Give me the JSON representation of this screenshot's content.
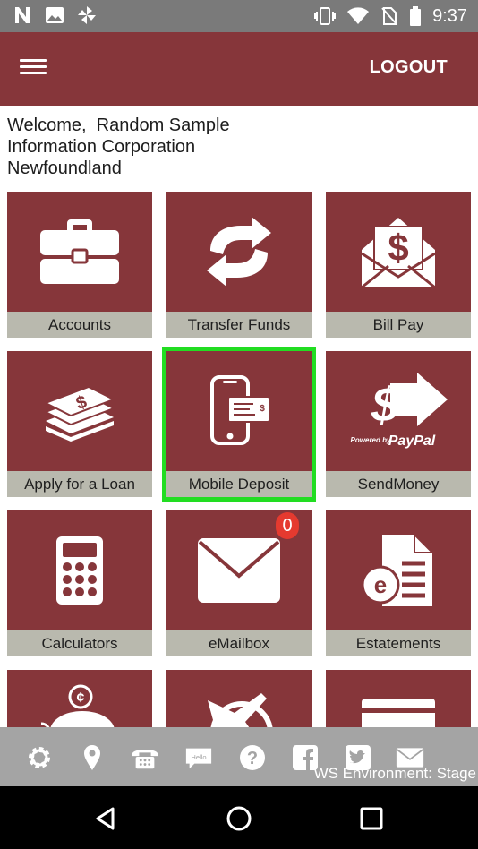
{
  "status_bar": {
    "time": "9:37",
    "left_icons": [
      "n-notification-icon",
      "image-icon",
      "pinwheel-icon"
    ],
    "right_icons": [
      "vibrate-icon",
      "wifi-icon",
      "no-sim-icon",
      "battery-icon"
    ]
  },
  "app_bar": {
    "menu_icon": "hamburger-menu-icon",
    "logout_label": "LOGOUT",
    "color": "#86363a"
  },
  "welcome": {
    "line1": "Welcome,  Random Sample",
    "line2": "Information Corporation",
    "line3": "Newfoundland"
  },
  "tiles": [
    {
      "label": "Accounts",
      "icon": "briefcase-icon"
    },
    {
      "label": "Transfer Funds",
      "icon": "transfer-arrows-icon"
    },
    {
      "label": "Bill Pay",
      "icon": "bill-envelope-icon"
    },
    {
      "label": "Apply for a Loan",
      "icon": "money-stack-icon"
    },
    {
      "label": "Mobile Deposit",
      "icon": "mobile-check-deposit-icon",
      "highlighted": true
    },
    {
      "label": "SendMoney",
      "icon": "paypal-send-icon",
      "brand_text": "Powered by",
      "brand_name": "PayPal"
    },
    {
      "label": "Calculators",
      "icon": "calculator-icon"
    },
    {
      "label": "eMailbox",
      "icon": "mail-envelope-icon",
      "badge": "0"
    },
    {
      "label": "Estatements",
      "icon": "estatement-icon"
    },
    {
      "label": "",
      "icon": "piggy-bank-icon"
    },
    {
      "label": "",
      "icon": "globe-plane-icon"
    },
    {
      "label": "",
      "icon": "card-icon"
    }
  ],
  "bottom_toolbar": {
    "icons": [
      "settings-icon",
      "location-icon",
      "phone-icon",
      "chat-hello-icon",
      "help-icon",
      "facebook-icon",
      "twitter-icon",
      "email-icon"
    ],
    "chat_text": "Hello",
    "env_label": "WS Environment: Stage"
  },
  "nav_bar": {
    "icons": [
      "back-icon",
      "home-icon",
      "recents-icon"
    ]
  },
  "colors": {
    "tile": "#86363a",
    "tile_label_bg": "#b9b9ae",
    "highlight": "#22dd22",
    "badge": "#e53a2f"
  }
}
